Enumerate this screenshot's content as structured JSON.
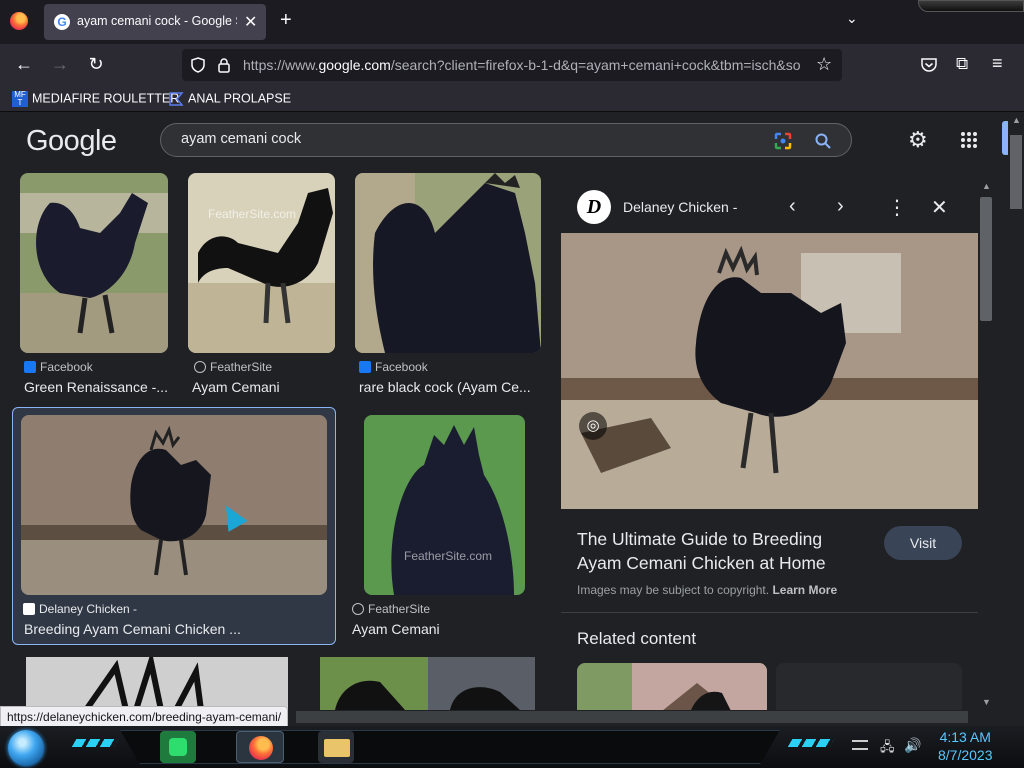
{
  "browser": {
    "tab_title": "ayam cemani cock - Google Se",
    "new_tab_label": "+",
    "url_prefix": "https://www.",
    "url_host": "google.com",
    "url_rest": "/search?client=firefox-b-1-d&q=ayam+cemani+cock&tbm=isch&so",
    "bookmarks": [
      {
        "label": "MEDIAFIRE ROULETTER",
        "icon": "mediafire-icon"
      },
      {
        "label": "ANAL PROLAPSE",
        "icon": "bookmark-flag-icon"
      }
    ]
  },
  "google": {
    "logo": "Google",
    "search_value": "ayam cemani cock"
  },
  "results": [
    {
      "source": "Facebook",
      "caption": "Green Renaissance -...",
      "icon": "facebook-icon"
    },
    {
      "source": "FeatherSite",
      "caption": "Ayam Cemani",
      "icon": "globe-icon",
      "watermark": "FeatherSite.com"
    },
    {
      "source": "Facebook",
      "caption": "rare black cock (Ayam Ce...",
      "icon": "facebook-icon"
    },
    {
      "source": "Delaney Chicken -",
      "caption": "Breeding Ayam Cemani Chicken ...",
      "icon": "delaney-icon",
      "selected": true
    },
    {
      "source": "FeatherSite",
      "caption": "Ayam Cemani",
      "icon": "globe-icon",
      "watermark": "FeatherSite.com"
    }
  ],
  "panel": {
    "logo_letter": "D",
    "source": "Delaney Chicken -",
    "title": "The Ultimate Guide to Breeding Ayam Cemani Chicken at Home",
    "visit": "Visit",
    "copyright_text": "Images may be subject to copyright.",
    "learn_more": "Learn More",
    "related_title": "Related content"
  },
  "status_url": "https://delaneychicken.com/breeding-ayam-cemani/",
  "taskbar": {
    "time": "4:13 AM",
    "date": "8/7/2023"
  },
  "colors": {
    "accent": "#8ab4f8",
    "page_bg": "#202124",
    "chrome_bg": "#2b2a33"
  }
}
